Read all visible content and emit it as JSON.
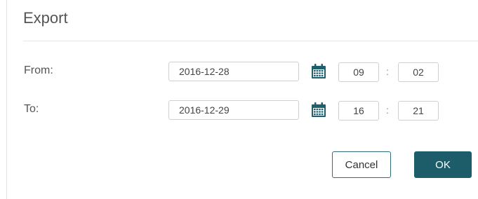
{
  "dialog": {
    "title": "Export",
    "from": {
      "label": "From:",
      "date": "2016-12-28",
      "hour": "09",
      "minute": "02",
      "separator": ":"
    },
    "to": {
      "label": "To:",
      "date": "2016-12-29",
      "hour": "16",
      "minute": "21",
      "separator": ":"
    },
    "cancel_label": "Cancel",
    "ok_label": "OK",
    "calendar_icon": "calendar-icon",
    "colors": {
      "accent": "#1d5d6a",
      "icon": "#1f5f6b"
    }
  }
}
